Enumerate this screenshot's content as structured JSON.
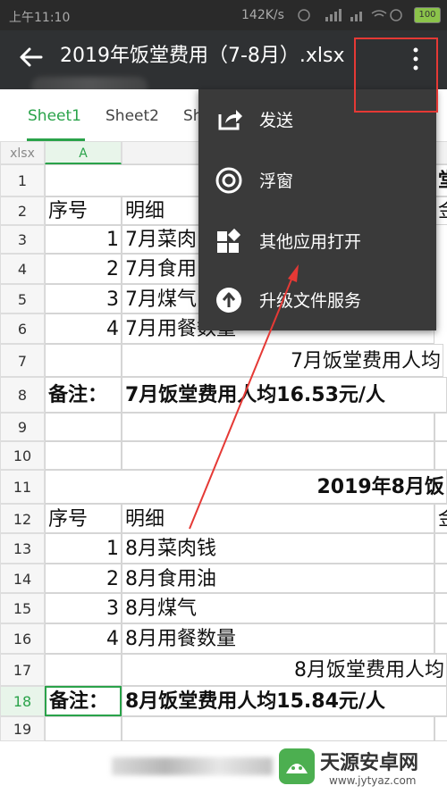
{
  "status": {
    "time": "上午11:10",
    "speed": "142K/s",
    "battery": "100"
  },
  "header": {
    "title": "2019年饭堂费用（7-8月）.xlsx"
  },
  "tabs": [
    "Sheet1",
    "Sheet2",
    "Sh"
  ],
  "grid": {
    "corner": "xlsx",
    "col_a": "A",
    "row_numbers": [
      "1",
      "2",
      "3",
      "4",
      "5",
      "6",
      "7",
      "8",
      "9",
      "10",
      "11",
      "12",
      "13",
      "14",
      "15",
      "16",
      "17",
      "18",
      "19"
    ],
    "cells": {
      "r1_tail": "堂",
      "r2": [
        "序号",
        "明细",
        "金"
      ],
      "r3": [
        "1",
        "7月菜肉"
      ],
      "r4": [
        "2",
        "7月食用"
      ],
      "r5": [
        "3",
        "7月煤气"
      ],
      "r6": [
        "4",
        "7月用餐数量"
      ],
      "r7": "7月饭堂费用人均",
      "r8": [
        "备注：",
        "7月饭堂费用人均16.53元/人"
      ],
      "r11": "2019年8月饭",
      "r12": [
        "序号",
        "明细",
        "金"
      ],
      "r13": [
        "1",
        "8月菜肉钱"
      ],
      "r14": [
        "2",
        "8月食用油"
      ],
      "r15": [
        "3",
        "8月煤气"
      ],
      "r16": [
        "4",
        "8月用餐数量"
      ],
      "r17": "8月饭堂费用人均",
      "r18": [
        "备注：",
        "8月饭堂费用人均15.84元/人"
      ]
    }
  },
  "menu": {
    "items": [
      {
        "label": "发送",
        "icon": "share-icon"
      },
      {
        "label": "浮窗",
        "icon": "floating-window-icon"
      },
      {
        "label": "其他应用打开",
        "icon": "open-with-apps-icon"
      },
      {
        "label": "升级文件服务",
        "icon": "upgrade-arrow-icon"
      }
    ]
  },
  "watermark": {
    "title": "天源安卓网",
    "url": "www.jytyaz.com"
  },
  "colors": {
    "accent": "#2aa34a",
    "toolbar": "#2f3133",
    "menu": "#3a3a3a",
    "annotation": "#e53935"
  }
}
